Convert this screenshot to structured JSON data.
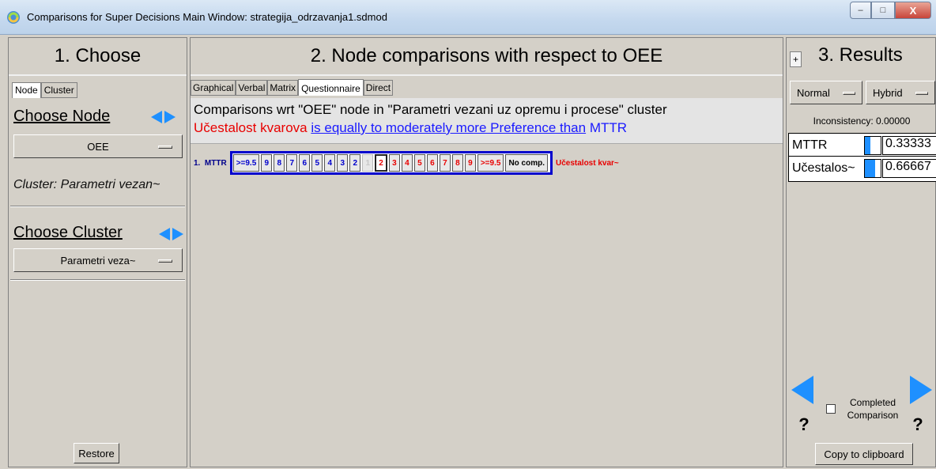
{
  "window": {
    "title": "Comparisons for Super Decisions Main Window: strategija_odrzavanja1.sdmod",
    "minimize": "–",
    "maximize": "□",
    "close": "X"
  },
  "left": {
    "title": "1. Choose",
    "tabs": [
      "Node",
      "Cluster"
    ],
    "choose_node_label": "Choose Node",
    "node_selected": "OEE",
    "cluster_line": "Cluster: Parametri vezan~",
    "choose_cluster_label": "Choose Cluster",
    "cluster_selected": "Parametri veza~",
    "restore_label": "Restore"
  },
  "middle": {
    "title": "2. Node comparisons with respect to OEE",
    "tabs": [
      "Graphical",
      "Verbal",
      "Matrix",
      "Questionnaire",
      "Direct"
    ],
    "active_tab": "Questionnaire",
    "line1": "Comparisons wrt \"OEE\" node in \"Parametri vezani uz opremu i procese\" cluster",
    "line2_left": "Učestalost kvarova",
    "line2_mid": "is equally to moderately more Preference than",
    "line2_right": "MTTR",
    "row_index": "1.",
    "row_left": "MTTR",
    "scale_left": [
      ">=9.5",
      "9",
      "8",
      "7",
      "6",
      "5",
      "4",
      "3",
      "2"
    ],
    "scale_center": "1",
    "scale_right": [
      "2",
      "3",
      "4",
      "5",
      "6",
      "7",
      "8",
      "9",
      ">=9.5"
    ],
    "selected_value": "2",
    "no_comp": "No comp.",
    "row_right": "Učestalost kvar~"
  },
  "right": {
    "plus": "+",
    "title": "3. Results",
    "mode": "Normal",
    "method": "Hybrid",
    "inconsistency": "Inconsistency: 0.00000",
    "results": [
      {
        "name": "MTTR",
        "value": "0.33333",
        "level": 0.33333
      },
      {
        "name": "Učestalos~",
        "value": "0.66667",
        "level": 0.66667
      }
    ],
    "question_mark": "?",
    "completed_label": "Completed Comparison",
    "copy_label": "Copy to clipboard"
  },
  "colors": {
    "accent_blue": "#1e90ff",
    "text_red": "#e80000",
    "text_blue": "#1a1aff",
    "scale_border": "#0000cd"
  }
}
